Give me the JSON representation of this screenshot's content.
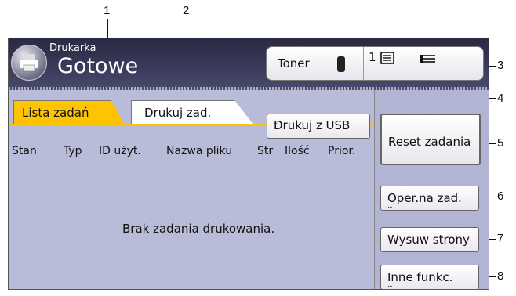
{
  "callouts": [
    "1",
    "2",
    "3",
    "4",
    "5",
    "6",
    "7",
    "8"
  ],
  "header": {
    "mode_label": "Drukarka",
    "status": "Gotowe",
    "toner_label": "Toner",
    "queue_count": "1"
  },
  "tabs": [
    {
      "label": "Lista zadań",
      "active": true
    },
    {
      "label": "Drukuj zad.",
      "active": false
    }
  ],
  "usb_button": "Drukuj z USB",
  "columns": [
    "Stan",
    "Typ",
    "ID użyt.",
    "Nazwa pliku",
    "Str",
    "Ilość",
    "Prior."
  ],
  "empty_message": "Brak zadania drukowania.",
  "side_buttons": {
    "reset": "Reset zadania",
    "oper": "Oper.na zad.",
    "wysuw": "Wysuw strony",
    "inne": "Inne funkc."
  },
  "colors": {
    "tab_active": "#ffc400",
    "header": "#2f2f4d",
    "panel": "#b9bcd8"
  }
}
